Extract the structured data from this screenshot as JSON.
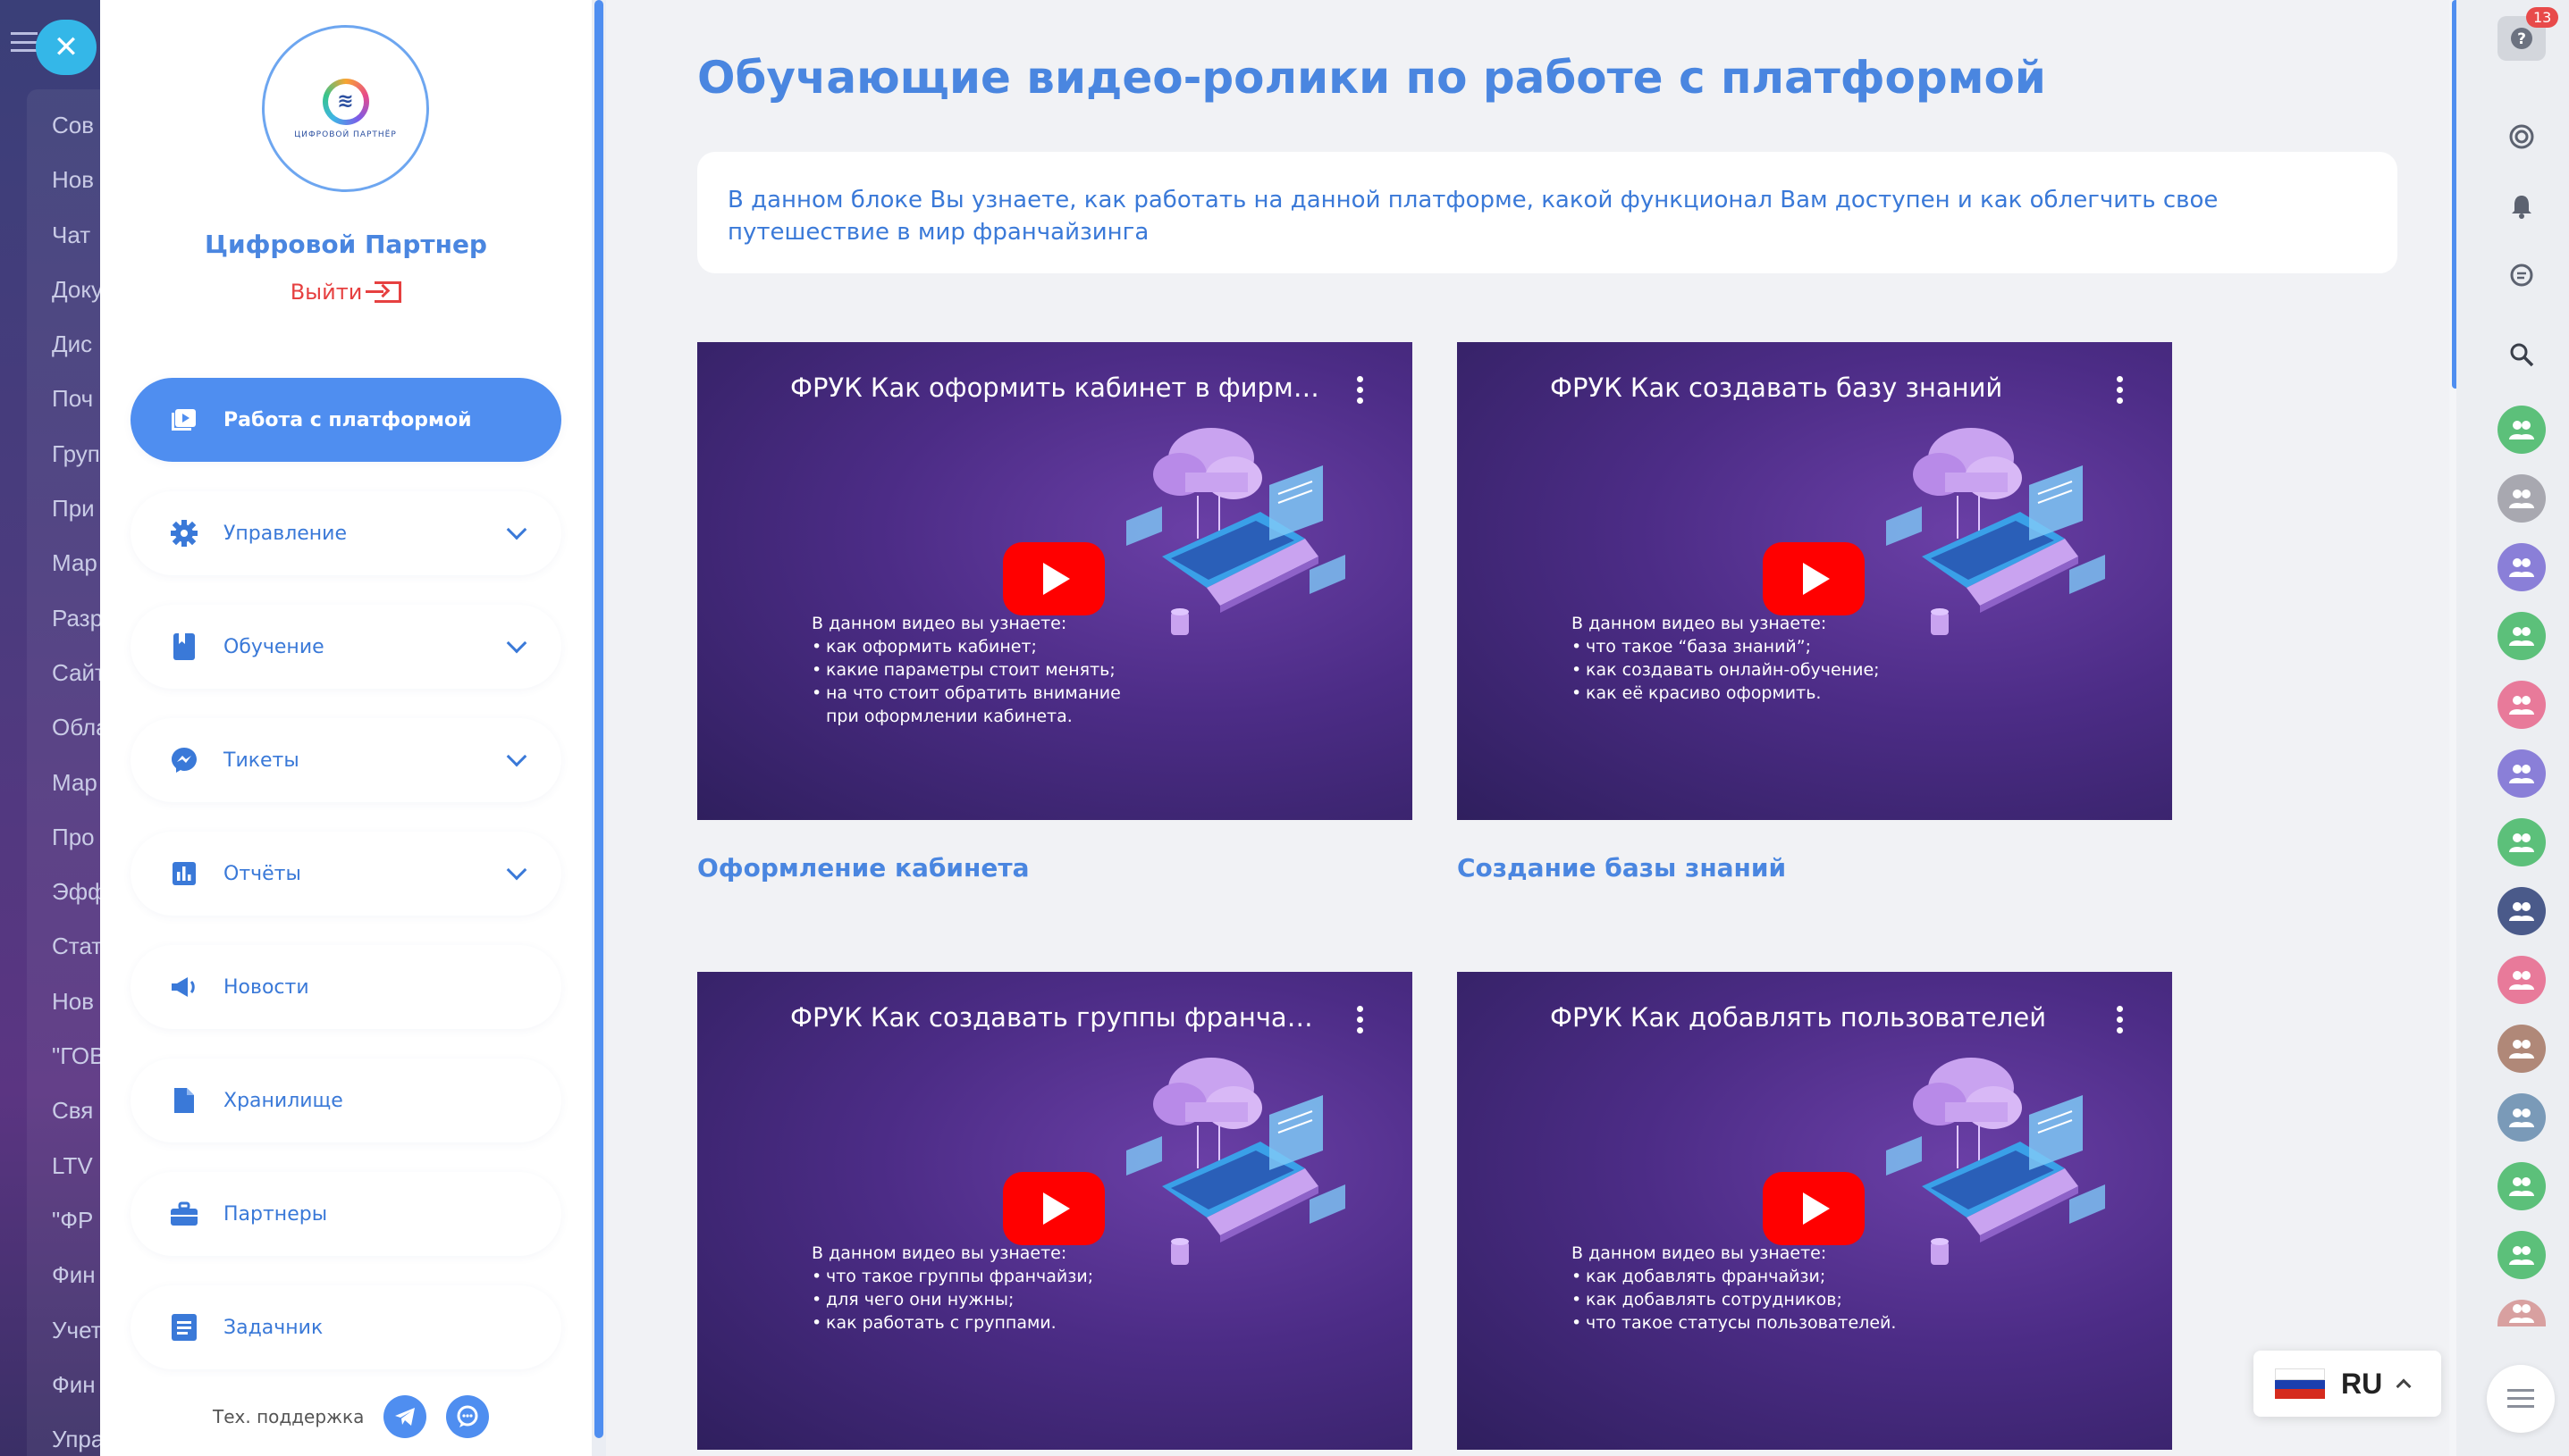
{
  "background_app": {
    "items": [
      "Сов",
      "Нов",
      "Чат",
      "Доку",
      "Дис",
      "Поч",
      "Груп",
      "При",
      "Мар",
      "Разр",
      "Сайт",
      "Обла",
      "Мар",
      "Про",
      "Эфф",
      "Стат",
      "Нов",
      "\"ГОВ",
      "Свя",
      "LTV",
      "\"ФР",
      "Фин",
      "Учет",
      "Фин",
      "Упра"
    ]
  },
  "sidebar": {
    "company_name": "Цифровой Партнер",
    "logo_caption": "ЦИФРОВОЙ ПАРТНЁР",
    "logout_label": "Выйти",
    "nav": [
      {
        "label": "Работа с платформой",
        "icon": "video-library-icon",
        "active": true,
        "has_chevron": false
      },
      {
        "label": "Управление",
        "icon": "gear-icon",
        "active": false,
        "has_chevron": true
      },
      {
        "label": "Обучение",
        "icon": "book-icon",
        "active": false,
        "has_chevron": true
      },
      {
        "label": "Тикеты",
        "icon": "messenger-icon",
        "active": false,
        "has_chevron": true
      },
      {
        "label": "Отчёты",
        "icon": "bar-chart-icon",
        "active": false,
        "has_chevron": true
      },
      {
        "label": "Новости",
        "icon": "megaphone-icon",
        "active": false,
        "has_chevron": false
      },
      {
        "label": "Хранилище",
        "icon": "file-icon",
        "active": false,
        "has_chevron": false
      },
      {
        "label": "Партнеры",
        "icon": "briefcase-icon",
        "active": false,
        "has_chevron": false
      },
      {
        "label": "Задачник",
        "icon": "task-list-icon",
        "active": false,
        "has_chevron": false
      }
    ],
    "support_label": "Тех. поддержка"
  },
  "main": {
    "title": "Обучающие видео-ролики по работе с платформой",
    "intro": "В данном блоке Вы узнаете, как работать на данной платформе, какой функционал Вам доступен и как облегчить свое путешествие в мир франчайзинга",
    "videos": [
      {
        "title": "ФРУК Как оформить кабинет в фирмен...",
        "desc_lead": "В данном видео вы узнаете:",
        "bullets": [
          "как оформить кабинет;",
          "какие параметры стоит менять;",
          "на что стоит обратить внимание при оформлении кабинета."
        ],
        "caption": "Оформление кабинета"
      },
      {
        "title": "ФРУК Как создавать базу знаний",
        "desc_lead": "В данном видео вы узнаете:",
        "bullets": [
          "что такое “база знаний”;",
          "как создавать онлайн-обучение;",
          "как её красиво оформить."
        ],
        "caption": "Создание базы знаний"
      },
      {
        "title": "ФРУК Как создавать группы франчайзи",
        "desc_lead": "В данном видео вы узнаете:",
        "bullets": [
          "что такое группы франчайзи;",
          "для чего они нужны;",
          "как работать с группами."
        ],
        "caption": ""
      },
      {
        "title": "ФРУК Как добавлять пользователей",
        "desc_lead": "В данном видео вы узнаете:",
        "bullets": [
          "как добавлять франчайзи;",
          "как добавлять сотрудников;",
          "что такое статусы пользователей."
        ],
        "caption": ""
      }
    ]
  },
  "rail": {
    "help_badge": "13",
    "language": "RU",
    "flag_colors": [
      "#ffffff",
      "#1c3fae",
      "#d52b1e"
    ]
  },
  "colors": {
    "accent": "#4f8ef0",
    "title": "#4a86e0",
    "logout": "#e64040",
    "youtube": "#ff0000"
  }
}
